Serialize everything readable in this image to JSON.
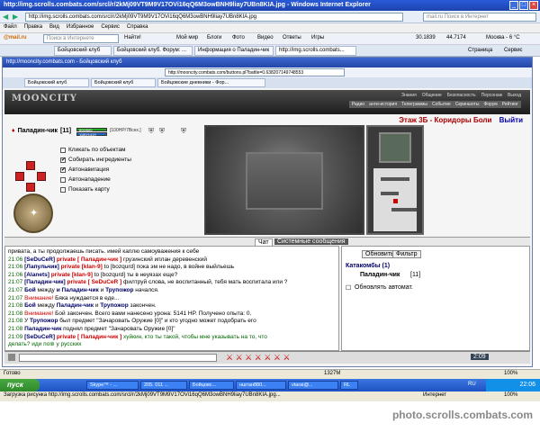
{
  "outer_window": {
    "title": "http://img.scrolls.combats.com/srcl/r/2kMj09VT9M9V17OVi16qQ6M3owBNH9liay7UBn8KIA.jpg - Windows Internet Explorer",
    "address": "http://img.scrolls.combats.com/srcl/r/2kMj09VT9M9V17OVi16qQ6M3owBNH9liay7UBn8KIA.jpg",
    "search_placeholder": "mail.ru Поиск в Интернет",
    "menu": [
      "Файл",
      "Правка",
      "Вид",
      "Избранное",
      "Сервис",
      "Справка"
    ],
    "toolbar": {
      "mail": "@mail.ru",
      "search": "Поиск в Интернете",
      "items": [
        "Мой мир",
        "Блоги",
        "Фото",
        "Видео",
        "Ответы",
        "Игры"
      ],
      "find_label": "Найти!",
      "ticker1": "30.1839",
      "ticker2": "44.7174",
      "weather": "Москва - 6 °C"
    },
    "tabs": [
      {
        "label": "Бойцовский клуб"
      },
      {
        "label": "Бойцовский клуб. Форум: ..."
      },
      {
        "label": "Информация о Паладин-чик"
      },
      {
        "label": "http://img.scrolls.combats..."
      }
    ],
    "tab_extras": [
      "Страница",
      "Сервис"
    ]
  },
  "inner_window": {
    "title": "http://mooncity.combats.com - Бойцовский клуб",
    "address": "http://mooncity.combats.com/buttons.pl?battle=0.638207149748553",
    "tabs": [
      "Бойцовский клуб",
      "Бойцовский клуб",
      "Бойцовские дневники - Фор..."
    ]
  },
  "game": {
    "logo": "MOONCITY",
    "nav_top": [
      "Знания",
      "Общение",
      "Безопасность",
      "Персонаж",
      "Выход"
    ],
    "nav_bottom": [
      "Радио",
      "анти-история",
      "Телеграммы",
      "Событие",
      "Скриншоты",
      "Форум",
      "Рейтинг"
    ],
    "location": "Этаж 3Б - Коридоры Боли",
    "exit_label": "Выйти",
    "player": {
      "name": "Паладин-чик",
      "level": "[11]",
      "hp_text": "[100HP/7Всех.]",
      "bar_hp": "800/800",
      "bar_mp": "1180/1419"
    },
    "options": [
      {
        "label": "Кликать по объектам",
        "checked": false
      },
      {
        "label": "Собирать ингредиенты",
        "checked": true
      },
      {
        "label": "Автонавигация",
        "checked": true
      },
      {
        "label": "Автонападение",
        "checked": false
      },
      {
        "label": "Показать карту",
        "checked": false
      }
    ]
  },
  "chat": {
    "tabs": [
      "Чат",
      "Системные сообщения"
    ],
    "lines": [
      {
        "time": "",
        "parts": [
          {
            "c": "sys",
            "t": "привата, а ты продолжаешь писать. имей каплю самоуважения к себе"
          }
        ]
      },
      {
        "time": "21:06",
        "parts": [
          {
            "c": "n",
            "t": "[SeDuCeR]"
          },
          {
            "c": "pr",
            "t": " private [ Паладин-чик ]"
          },
          {
            "c": "sys",
            "t": " грузинский иплан деревенский"
          }
        ]
      },
      {
        "time": "21:06",
        "parts": [
          {
            "c": "n",
            "t": "[Лапульчик]"
          },
          {
            "c": "pr",
            "t": " private [klan-9]"
          },
          {
            "c": "sys",
            "t": " to [bozqurd] пока эм не надо, в войне выйльешь"
          }
        ]
      },
      {
        "time": "21:06",
        "parts": [
          {
            "c": "n",
            "t": "[Alanets]"
          },
          {
            "c": "pr",
            "t": " private [klan-9]"
          },
          {
            "c": "sys",
            "t": " to [bozqurd] ты в неуязах еще?"
          }
        ]
      },
      {
        "time": "21:07",
        "parts": [
          {
            "c": "n",
            "t": "[Паладин-чик]"
          },
          {
            "c": "pr",
            "t": " private [ SeDuCeR ]"
          },
          {
            "c": "sys",
            "t": " филтруй слова, не воспитанный, тебя мать воспитала или ?"
          }
        ]
      },
      {
        "time": "21:07",
        "parts": [
          {
            "c": "n",
            "t": "Бой"
          },
          {
            "c": "sys",
            "t": " между "
          },
          {
            "c": "n",
            "t": "и Паладин-чик"
          },
          {
            "c": "sys",
            "t": " и "
          },
          {
            "c": "n",
            "t": "Трупожор"
          },
          {
            "c": "sys",
            "t": " начался."
          }
        ]
      },
      {
        "time": "21:07",
        "parts": [
          {
            "c": "warn",
            "t": "Внимание!"
          },
          {
            "c": "sys",
            "t": " Бяка нуждается в еде..."
          }
        ]
      },
      {
        "time": "21:08",
        "parts": [
          {
            "c": "n",
            "t": "Бой"
          },
          {
            "c": "sys",
            "t": " между "
          },
          {
            "c": "n",
            "t": "Паладин-чик"
          },
          {
            "c": "sys",
            "t": " и "
          },
          {
            "c": "n",
            "t": "Трупожор"
          },
          {
            "c": "sys",
            "t": " закончен."
          }
        ]
      },
      {
        "time": "21:08",
        "parts": [
          {
            "c": "warn",
            "t": "Внимание!"
          },
          {
            "c": "sys",
            "t": " Бой закончен. Всего вами нанесено урона: 5141 HP. Получено опыта: 0."
          }
        ]
      },
      {
        "time": "21:08",
        "parts": [
          {
            "c": "sys",
            "t": "У "
          },
          {
            "c": "n",
            "t": "Трупожор"
          },
          {
            "c": "sys",
            "t": " был предмет \"Зачаровать Оружие [0]\" и кто угодно может подобрать его"
          }
        ]
      },
      {
        "time": "21:08",
        "parts": [
          {
            "c": "n",
            "t": "Паладин-чик"
          },
          {
            "c": "sys",
            "t": " поднял предмет \"Зачаровать Оружие [0]\""
          }
        ]
      },
      {
        "time": "21:09",
        "parts": [
          {
            "c": "n",
            "t": "[SeDuCeR]"
          },
          {
            "c": "pr",
            "t": " private [ Паладин-чик ]"
          },
          {
            "c": "t",
            "t": " хуйкин, кто ты такой, чтобы мне указывать на то, что"
          }
        ]
      },
      {
        "time": "",
        "parts": [
          {
            "c": "t",
            "t": "делать? иди по⊛ у русских"
          }
        ]
      }
    ]
  },
  "right_panel": {
    "buttons": [
      "Обновить",
      "Фильтр"
    ],
    "title": "Катакомбы (1)",
    "entry_name": "Паладин-чик",
    "entry_level": "[11]",
    "auto_refresh": "Обновлять автомат."
  },
  "status": {
    "left": "Готово",
    "ping": "1327M",
    "time_mini": "2:09",
    "zoom_label": "Интернет",
    "zoom": "100%"
  },
  "taskbar": {
    "start": "пуск",
    "items": [
      "Skype™ - ...",
      "205. 011 ...",
      "Бойцовс...",
      "нштан880...",
      "vtarai@...",
      "RL"
    ],
    "lang": "RU",
    "clock": "22:06"
  },
  "outer_status": {
    "text": "Загрузка рисунка http://img.scrolls.combats.com/srcl/r/2kMj09VT9M9V17OVi16qQ6M3owBNH9liay7UBn8KIA.jpg...",
    "zone": "Интернет",
    "zoom": "100%"
  },
  "watermark": "photo.scrolls.combats.com"
}
